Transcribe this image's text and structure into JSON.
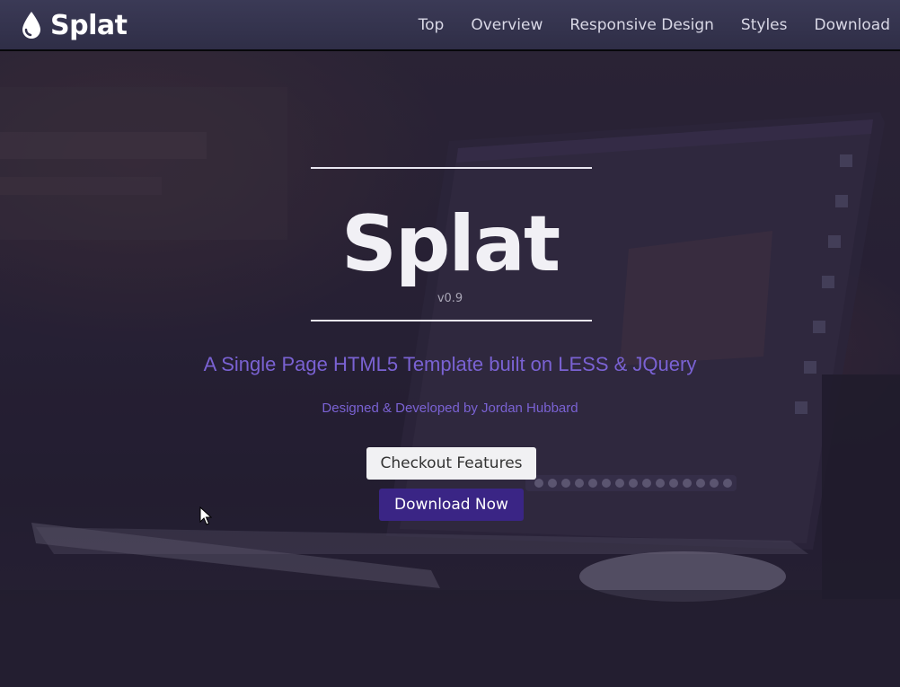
{
  "navbar": {
    "brand_name": "Splat",
    "brand_icon": "droplet-icon",
    "links": [
      "Top",
      "Overview",
      "Responsive Design",
      "Styles",
      "Download"
    ]
  },
  "hero": {
    "title": "Splat",
    "version": "v0.9",
    "tagline": "A Single Page HTML5 Template built on LESS & JQuery",
    "byline": "Designed & Developed by Jordan Hubbard",
    "buttons": {
      "features": "Checkout Features",
      "download": "Download Now"
    }
  },
  "colors": {
    "navbar": "#34334e",
    "accent": "#7a62d3",
    "primary_button": "#3a2585",
    "light_button": "#f1f1f3"
  }
}
